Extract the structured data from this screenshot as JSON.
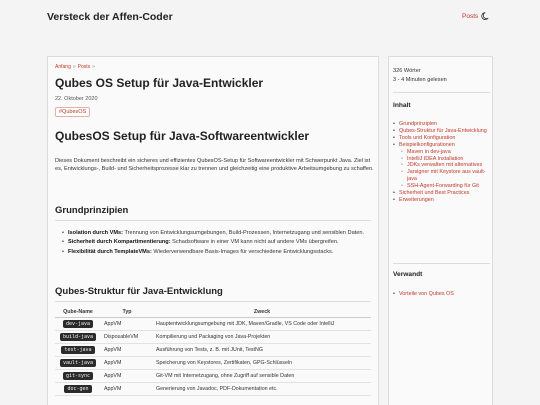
{
  "site": {
    "title": "Versteck der Affen-Coder",
    "nav_posts": "Posts",
    "theme_icon": "moon-icon"
  },
  "breadcrumb": {
    "home": "Anfang",
    "sep": "»",
    "posts": "Posts",
    "sep2": "»"
  },
  "post": {
    "title": "Qubes OS Setup für Java-Entwickler",
    "date": "22. Oktober 2020",
    "tag": "#QubesOS",
    "heading": "QubesOS Setup für Java-Softwareentwickler",
    "intro": "Dieses Dokument beschreibt ein sicheres und effizientes QubesOS-Setup für Softwareentwickler mit Schwerpunkt Java. Ziel ist es, Entwicklungs-, Build- und Sicherheitsprozesse klar zu trennen und gleichzeitig eine produktive Arbeitsumgebung zu schaffen.",
    "section1": {
      "title": "Grundprinzipien",
      "items": [
        {
          "label": "Isolation durch VMs:",
          "text": " Trennung von Entwicklungsumgebungen, Build-Prozessen, Internetzugang und sensiblen Daten."
        },
        {
          "label": "Sicherheit durch Kompartimentierung:",
          "text": " Schadsoftware in einer VM kann nicht auf andere VMs übergreifen."
        },
        {
          "label": "Flexibilität durch TemplateVMs:",
          "text": " Wiederverwendbare Basis-Images für verschiedene Entwicklungsstacks."
        }
      ]
    },
    "section2": {
      "title": "Qubes-Struktur für Java-Entwicklung",
      "headers": [
        "Qube-Name",
        "Typ",
        "Zweck"
      ],
      "rows": [
        [
          "dev-java",
          "AppVM",
          "Hauptentwicklungsumgebung mit JDK, Maven/Gradle, VS Code oder IntelliJ"
        ],
        [
          "build-java",
          "DisposableVM",
          "Kompilierung und Packaging von Java-Projekten"
        ],
        [
          "test-java",
          "AppVM",
          "Ausführung von Tests, z. B. mit JUnit, TestNG"
        ],
        [
          "vault-java",
          "AppVM",
          "Speicherung von Keystores, Zertifikaten, GPG-Schlüsseln"
        ],
        [
          "git-sync",
          "AppVM",
          "Git-VM mit Internetzugang, ohne Zugriff auf sensible Daten"
        ],
        [
          "doc-gen",
          "AppVM",
          "Generierung von Javadoc, PDF-Dokumentation etc."
        ]
      ]
    }
  },
  "sidebar": {
    "words": "326 Wörter",
    "reading": "3 - 4 Minuten gelesen",
    "toc_title": "Inhalt",
    "toc": [
      {
        "text": "Grundprinzipien",
        "sub": false
      },
      {
        "text": "Qubes-Struktur für Java-Entwicklung",
        "sub": false
      },
      {
        "text": "Tools und Konfiguration",
        "sub": false
      },
      {
        "text": "Beispielkonfigurationen",
        "sub": false
      },
      {
        "text": "Maven in dev-java",
        "sub": true
      },
      {
        "text": "IntelliJ IDEA Installation",
        "sub": true
      },
      {
        "text": "JDKs verwalten mit alternatives",
        "sub": true
      },
      {
        "text": "Jarsigner mit Keystore aus vault-java",
        "sub": true
      },
      {
        "text": "SSH-Agent-Forwarding für Git",
        "sub": true
      },
      {
        "text": "Sicherheit und Best Practices",
        "sub": false
      },
      {
        "text": "Erweiterungen",
        "sub": false
      }
    ],
    "related_title": "Verwandt",
    "related": [
      "Vorteile von Qubes OS"
    ]
  }
}
